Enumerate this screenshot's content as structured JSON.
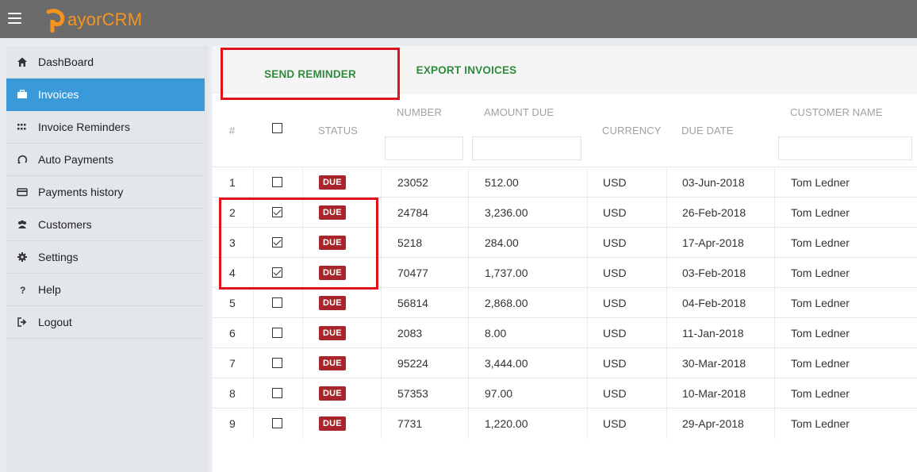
{
  "app": {
    "logo_text": "ayorCRM",
    "brand_color": "#f7941d"
  },
  "sidebar": {
    "items": [
      {
        "label": "DashBoard",
        "icon": "home-icon"
      },
      {
        "label": "Invoices",
        "icon": "briefcase-icon",
        "active": true
      },
      {
        "label": "Invoice Reminders",
        "icon": "grid-icon"
      },
      {
        "label": "Auto Payments",
        "icon": "refresh-icon"
      },
      {
        "label": "Payments history",
        "icon": "credit-card-icon"
      },
      {
        "label": "Customers",
        "icon": "users-icon"
      },
      {
        "label": "Settings",
        "icon": "gear-icon"
      },
      {
        "label": "Help",
        "icon": "question-icon"
      },
      {
        "label": "Logout",
        "icon": "logout-icon"
      }
    ]
  },
  "toolbar": {
    "send_label": "SEND REMINDER",
    "export_label": "EXPORT INVOICES"
  },
  "table": {
    "headers": {
      "index": "#",
      "status": "STATUS",
      "number": "NUMBER",
      "amount": "AMOUNT DUE",
      "currency": "CURRENCY",
      "due_date": "DUE DATE",
      "customer": "CUSTOMER NAME"
    },
    "rows": [
      {
        "index": "1",
        "checked": false,
        "status": "DUE",
        "number": "23052",
        "amount": "512.00",
        "currency": "USD",
        "due_date": "03-Jun-2018",
        "customer": "Tom Ledner"
      },
      {
        "index": "2",
        "checked": true,
        "status": "DUE",
        "number": "24784",
        "amount": "3,236.00",
        "currency": "USD",
        "due_date": "26-Feb-2018",
        "customer": "Tom Ledner"
      },
      {
        "index": "3",
        "checked": true,
        "status": "DUE",
        "number": "5218",
        "amount": "284.00",
        "currency": "USD",
        "due_date": "17-Apr-2018",
        "customer": "Tom Ledner"
      },
      {
        "index": "4",
        "checked": true,
        "status": "DUE",
        "number": "70477",
        "amount": "1,737.00",
        "currency": "USD",
        "due_date": "03-Feb-2018",
        "customer": "Tom Ledner"
      },
      {
        "index": "5",
        "checked": false,
        "status": "DUE",
        "number": "56814",
        "amount": "2,868.00",
        "currency": "USD",
        "due_date": "04-Feb-2018",
        "customer": "Tom Ledner"
      },
      {
        "index": "6",
        "checked": false,
        "status": "DUE",
        "number": "2083",
        "amount": "8.00",
        "currency": "USD",
        "due_date": "11-Jan-2018",
        "customer": "Tom Ledner"
      },
      {
        "index": "7",
        "checked": false,
        "status": "DUE",
        "number": "95224",
        "amount": "3,444.00",
        "currency": "USD",
        "due_date": "30-Mar-2018",
        "customer": "Tom Ledner"
      },
      {
        "index": "8",
        "checked": false,
        "status": "DUE",
        "number": "57353",
        "amount": "97.00",
        "currency": "USD",
        "due_date": "10-Mar-2018",
        "customer": "Tom Ledner"
      },
      {
        "index": "9",
        "checked": false,
        "status": "DUE",
        "number": "7731",
        "amount": "1,220.00",
        "currency": "USD",
        "due_date": "29-Apr-2018",
        "customer": "Tom Ledner"
      }
    ]
  }
}
